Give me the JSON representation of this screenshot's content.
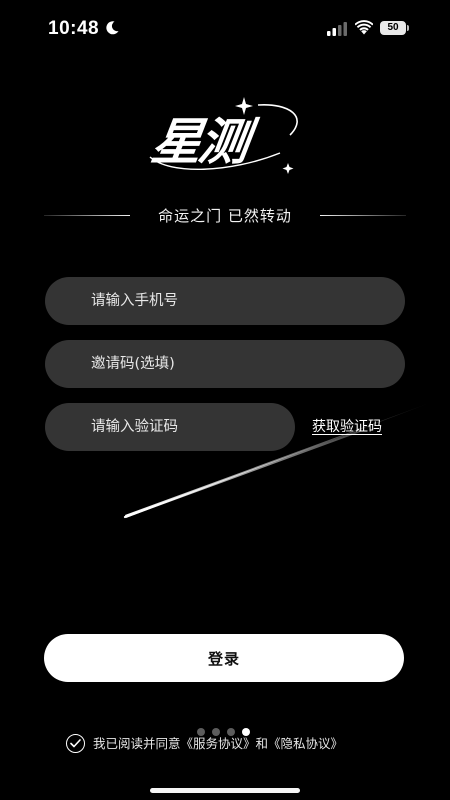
{
  "status_bar": {
    "time": "10:48",
    "battery": "50"
  },
  "logo": {
    "text": "星测"
  },
  "tagline": "命运之门 已然转动",
  "form": {
    "phone_placeholder": "请输入手机号",
    "invite_placeholder": "邀请码(选填)",
    "code_placeholder": "请输入验证码",
    "get_code_label": "获取验证码"
  },
  "login": {
    "label": "登录"
  },
  "agreement": {
    "prefix": "我已阅读并同意",
    "service_link": "《服务协议》",
    "conjunction": "和",
    "privacy_link": "《隐私协议》"
  },
  "pager": {
    "count": 4,
    "active_index": 3
  },
  "colors": {
    "background": "#000000",
    "input_fill": "#343434",
    "button_fill": "#ffffff"
  }
}
